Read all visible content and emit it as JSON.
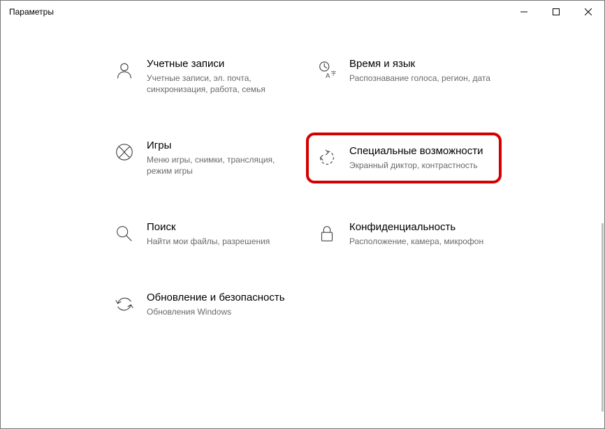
{
  "window": {
    "title": "Параметры"
  },
  "tiles": {
    "accounts": {
      "title": "Учетные записи",
      "desc": "Учетные записи, эл. почта, синхронизация, работа, семья"
    },
    "time": {
      "title": "Время и язык",
      "desc": "Распознавание голоса, регион, дата"
    },
    "gaming": {
      "title": "Игры",
      "desc": "Меню игры, снимки, трансляция, режим игры"
    },
    "ease": {
      "title": "Специальные возможности",
      "desc": "Экранный диктор, контрастность"
    },
    "search": {
      "title": "Поиск",
      "desc": "Найти мои файлы, разрешения"
    },
    "privacy": {
      "title": "Конфиденциальность",
      "desc": "Расположение, камера, микрофон"
    },
    "update": {
      "title": "Обновление и безопасность",
      "desc": "Обновления Windows"
    }
  }
}
